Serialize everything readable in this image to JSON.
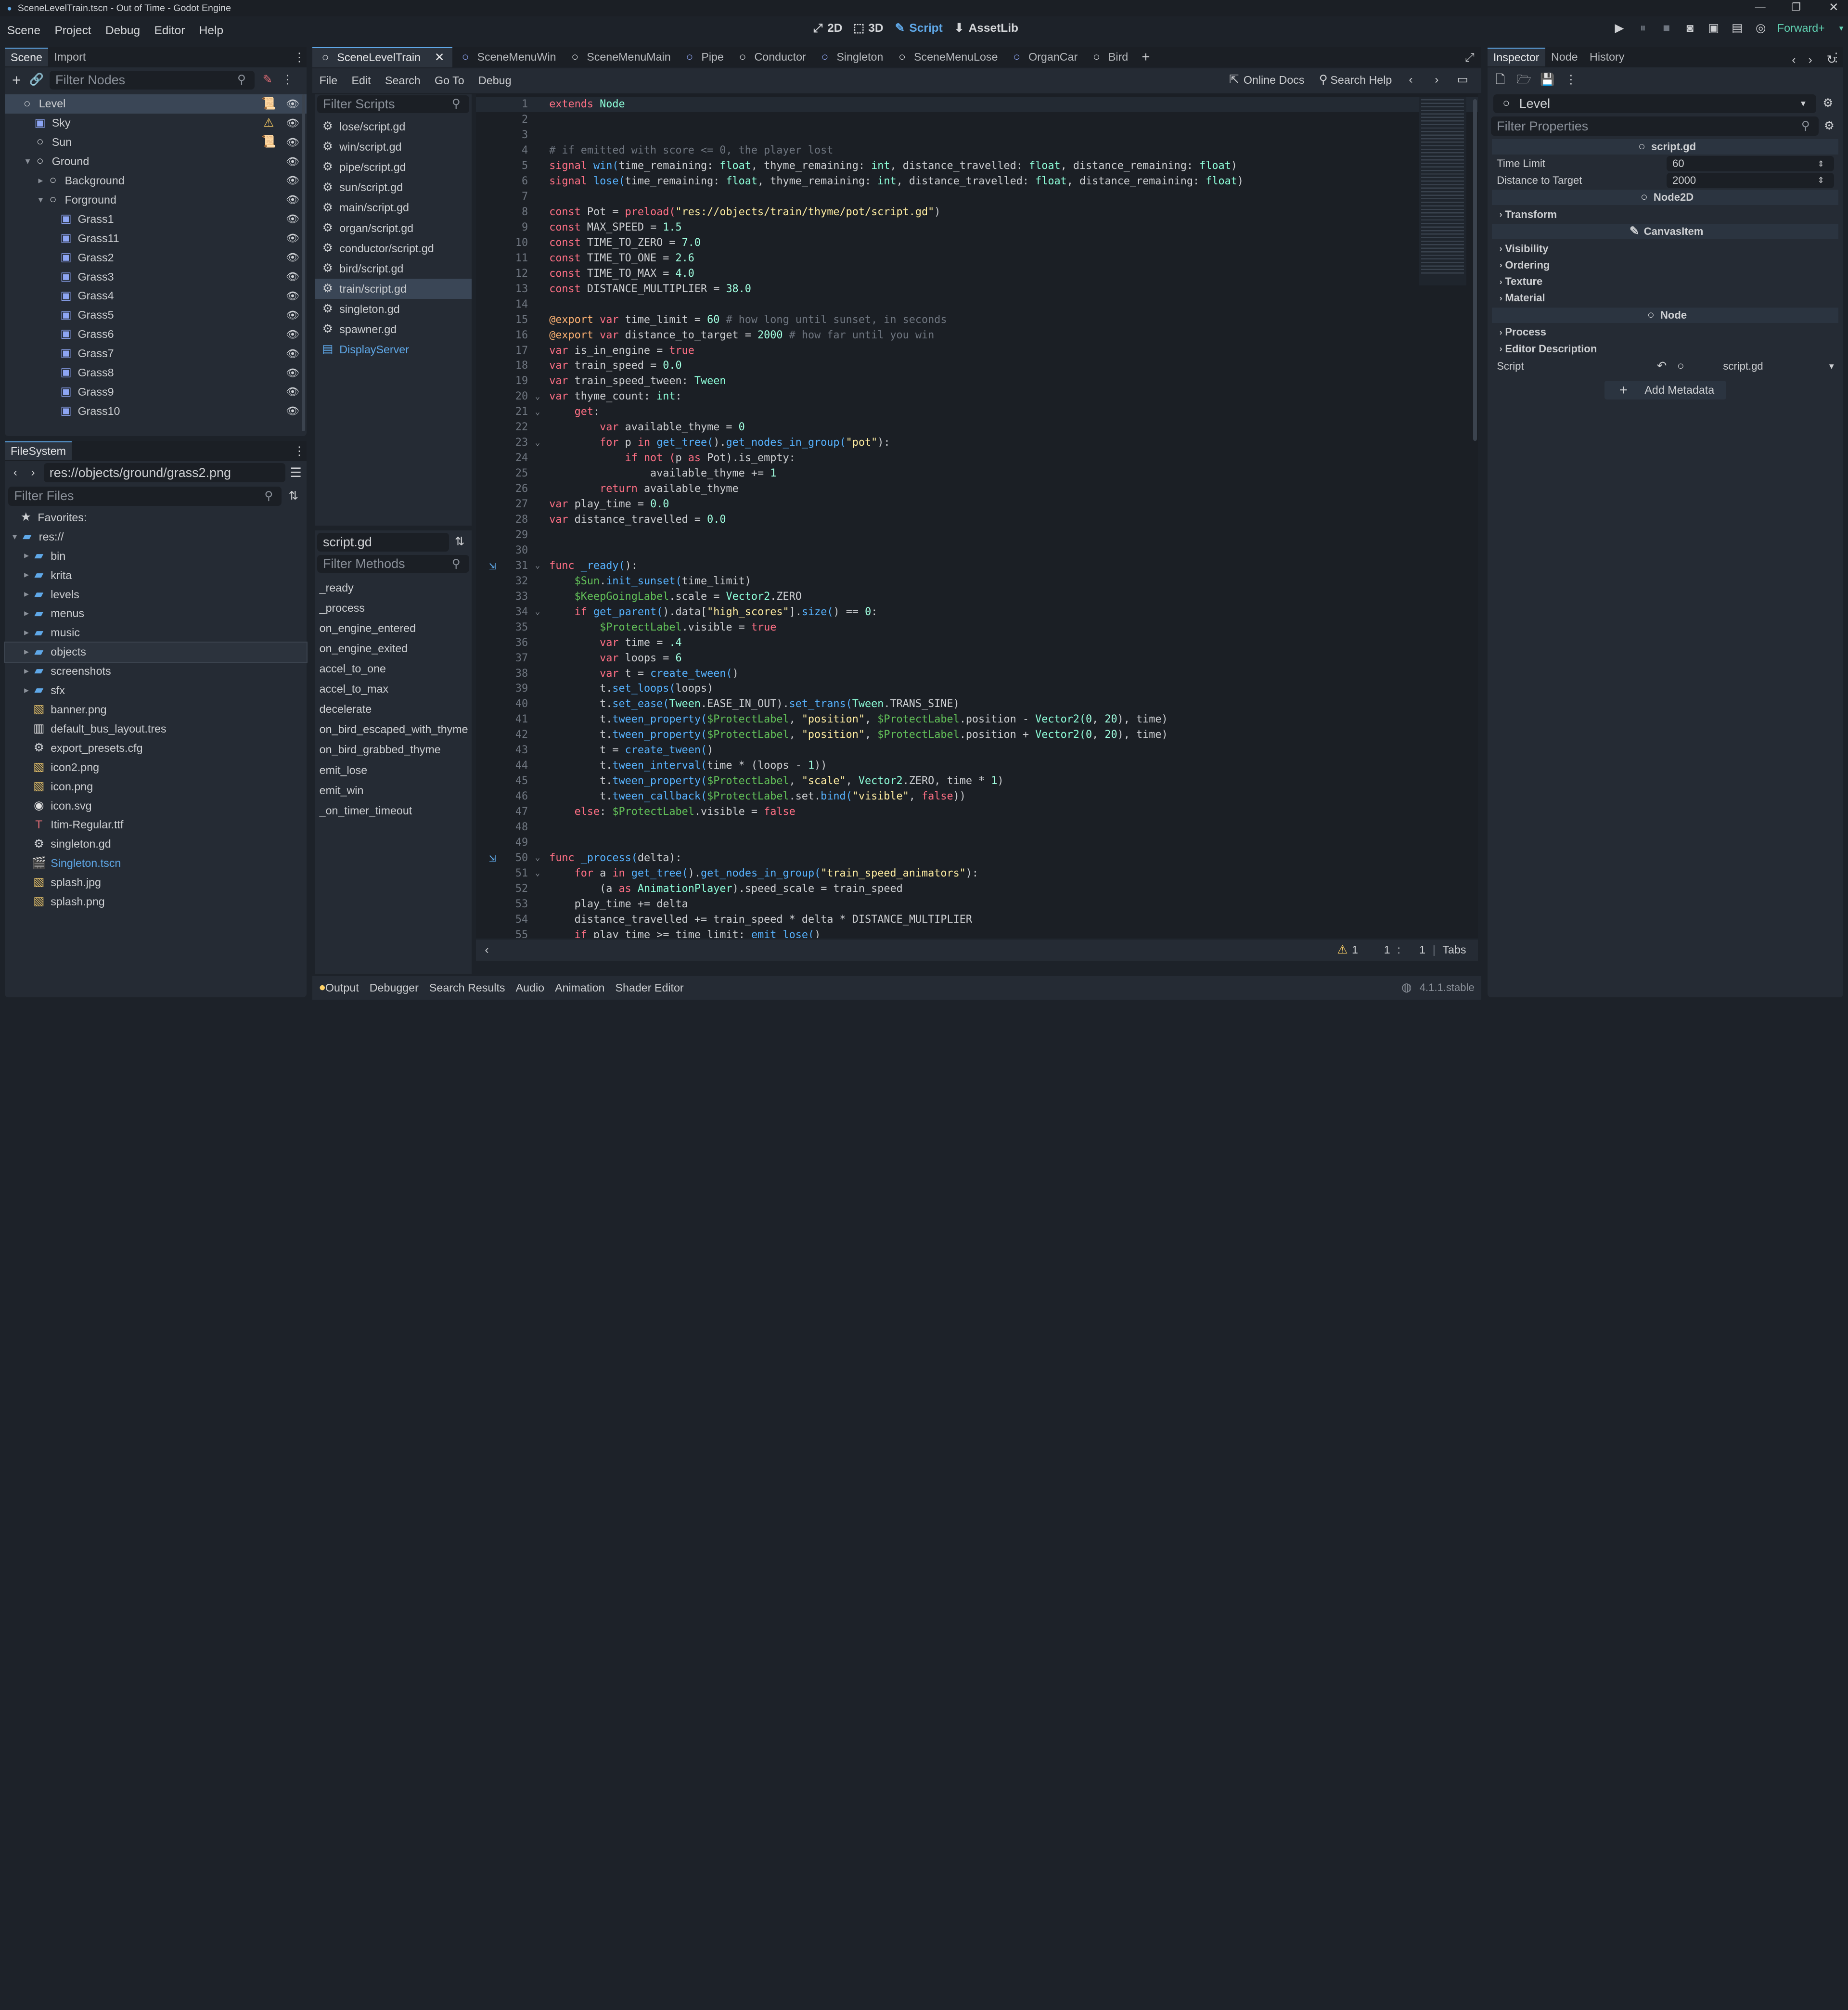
{
  "window": {
    "title": "SceneLevelTrain.tscn - Out of Time - Godot Engine"
  },
  "menu": {
    "items": [
      "Scene",
      "Project",
      "Debug",
      "Editor",
      "Help"
    ]
  },
  "workspaces": {
    "items": [
      "2D",
      "3D",
      "Script",
      "AssetLib"
    ],
    "active": "Script"
  },
  "renderer": {
    "label": "Forward+"
  },
  "scene_dock": {
    "tabs": [
      "Scene",
      "Import"
    ],
    "filter_placeholder": "Filter Nodes",
    "nodes": [
      {
        "name": "Level",
        "depth": 0,
        "icon": "node2d-icon",
        "selected": true
      },
      {
        "name": "Sky",
        "depth": 1,
        "icon": "sprite-icon",
        "warning": true
      },
      {
        "name": "Sun",
        "depth": 1,
        "icon": "node2d-icon",
        "script": true
      },
      {
        "name": "Ground",
        "depth": 1,
        "icon": "node2d-icon",
        "expanded": true
      },
      {
        "name": "Background",
        "depth": 2,
        "icon": "node2d-icon",
        "collapsed": true
      },
      {
        "name": "Forground",
        "depth": 2,
        "icon": "node2d-icon",
        "expanded": true
      },
      {
        "name": "Grass1",
        "depth": 3,
        "icon": "sprite-icon"
      },
      {
        "name": "Grass11",
        "depth": 3,
        "icon": "sprite-icon"
      },
      {
        "name": "Grass2",
        "depth": 3,
        "icon": "sprite-icon"
      },
      {
        "name": "Grass3",
        "depth": 3,
        "icon": "sprite-icon"
      },
      {
        "name": "Grass4",
        "depth": 3,
        "icon": "sprite-icon"
      },
      {
        "name": "Grass5",
        "depth": 3,
        "icon": "sprite-icon"
      },
      {
        "name": "Grass6",
        "depth": 3,
        "icon": "sprite-icon"
      },
      {
        "name": "Grass7",
        "depth": 3,
        "icon": "sprite-icon"
      },
      {
        "name": "Grass8",
        "depth": 3,
        "icon": "sprite-icon"
      },
      {
        "name": "Grass9",
        "depth": 3,
        "icon": "sprite-icon"
      },
      {
        "name": "Grass10",
        "depth": 3,
        "icon": "sprite-icon"
      }
    ]
  },
  "filesystem": {
    "title": "FileSystem",
    "path": "res://objects/ground/grass2.png",
    "filter_placeholder": "Filter Files",
    "favorites_label": "Favorites:",
    "items": [
      {
        "name": "res://",
        "depth": 0,
        "type": "folder",
        "expanded": true
      },
      {
        "name": "bin",
        "depth": 1,
        "type": "folder"
      },
      {
        "name": "krita",
        "depth": 1,
        "type": "folder"
      },
      {
        "name": "levels",
        "depth": 1,
        "type": "folder"
      },
      {
        "name": "menus",
        "depth": 1,
        "type": "folder"
      },
      {
        "name": "music",
        "depth": 1,
        "type": "folder"
      },
      {
        "name": "objects",
        "depth": 1,
        "type": "folder",
        "selected": true
      },
      {
        "name": "screenshots",
        "depth": 1,
        "type": "folder"
      },
      {
        "name": "sfx",
        "depth": 1,
        "type": "folder"
      },
      {
        "name": "banner.png",
        "depth": 1,
        "type": "image"
      },
      {
        "name": "default_bus_layout.tres",
        "depth": 1,
        "type": "resource"
      },
      {
        "name": "export_presets.cfg",
        "depth": 1,
        "type": "config"
      },
      {
        "name": "icon2.png",
        "depth": 1,
        "type": "image"
      },
      {
        "name": "icon.png",
        "depth": 1,
        "type": "image"
      },
      {
        "name": "icon.svg",
        "depth": 1,
        "type": "svg"
      },
      {
        "name": "Itim-Regular.ttf",
        "depth": 1,
        "type": "font"
      },
      {
        "name": "singleton.gd",
        "depth": 1,
        "type": "script"
      },
      {
        "name": "Singleton.tscn",
        "depth": 1,
        "type": "scene",
        "highlight": true
      },
      {
        "name": "splash.jpg",
        "depth": 1,
        "type": "image"
      },
      {
        "name": "splash.png",
        "depth": 1,
        "type": "image"
      }
    ]
  },
  "scene_tabs": [
    {
      "label": "SceneLevelTrain",
      "active": true,
      "closable": true
    },
    {
      "label": "SceneMenuWin"
    },
    {
      "label": "SceneMenuMain"
    },
    {
      "label": "Pipe"
    },
    {
      "label": "Conductor"
    },
    {
      "label": "Singleton"
    },
    {
      "label": "SceneMenuLose"
    },
    {
      "label": "OrganCar"
    },
    {
      "label": "Bird"
    }
  ],
  "script_menu": {
    "items": [
      "File",
      "Edit",
      "Search",
      "Go To",
      "Debug"
    ],
    "online_docs": "Online Docs",
    "search_help": "Search Help"
  },
  "scripts": {
    "filter_placeholder": "Filter Scripts",
    "items": [
      {
        "label": "lose/script.gd"
      },
      {
        "label": "win/script.gd"
      },
      {
        "label": "pipe/script.gd"
      },
      {
        "label": "sun/script.gd"
      },
      {
        "label": "main/script.gd"
      },
      {
        "label": "organ/script.gd"
      },
      {
        "label": "conductor/script.gd"
      },
      {
        "label": "bird/script.gd"
      },
      {
        "label": "train/script.gd",
        "selected": true
      },
      {
        "label": "singleton.gd"
      },
      {
        "label": "spawner.gd"
      },
      {
        "label": "DisplayServer",
        "doc": true
      }
    ],
    "current_file": "script.gd",
    "methods_filter_placeholder": "Filter Methods",
    "methods": [
      "_ready",
      "_process",
      "on_engine_entered",
      "on_engine_exited",
      "accel_to_one",
      "accel_to_max",
      "decelerate",
      "on_bird_escaped_with_thyme",
      "on_bird_grabbed_thyme",
      "emit_lose",
      "emit_win",
      "_on_timer_timeout"
    ]
  },
  "code": {
    "lines": [
      {
        "n": "1",
        "t": "extends Node"
      },
      {
        "n": "2",
        "t": ""
      },
      {
        "n": "3",
        "t": ""
      },
      {
        "n": "4",
        "t": "# if emitted with score <= 0, the player lost"
      },
      {
        "n": "5",
        "t": "signal win(time_remaining: float, thyme_remaining: int, distance_travelled: float, distance_remaining: float)"
      },
      {
        "n": "6",
        "t": "signal lose(time_remaining: float, thyme_remaining: int, distance_travelled: float, distance_remaining: float)"
      },
      {
        "n": "7",
        "t": ""
      },
      {
        "n": "8",
        "t": "const Pot = preload(\"res://objects/train/thyme/pot/script.gd\")"
      },
      {
        "n": "9",
        "t": "const MAX_SPEED = 1.5"
      },
      {
        "n": "10",
        "t": "const TIME_TO_ZERO = 7.0"
      },
      {
        "n": "11",
        "t": "const TIME_TO_ONE = 2.6"
      },
      {
        "n": "12",
        "t": "const TIME_TO_MAX = 4.0"
      },
      {
        "n": "13",
        "t": "const DISTANCE_MULTIPLIER = 38.0"
      },
      {
        "n": "14",
        "t": ""
      },
      {
        "n": "15",
        "t": "@export var time_limit = 60 # how long until sunset, in seconds"
      },
      {
        "n": "16",
        "t": "@export var distance_to_target = 2000 # how far until you win"
      },
      {
        "n": "17",
        "t": "var is_in_engine = true"
      },
      {
        "n": "18",
        "t": "var train_speed = 0.0"
      },
      {
        "n": "19",
        "t": "var train_speed_tween: Tween"
      },
      {
        "n": "20",
        "t": "var thyme_count: int:",
        "fold": true
      },
      {
        "n": "21",
        "t": "    get:",
        "fold": true
      },
      {
        "n": "22",
        "t": "        var available_thyme = 0"
      },
      {
        "n": "23",
        "t": "        for p in get_tree().get_nodes_in_group(\"pot\"):",
        "fold": true
      },
      {
        "n": "24",
        "t": "            if not (p as Pot).is_empty:"
      },
      {
        "n": "25",
        "t": "                available_thyme += 1"
      },
      {
        "n": "26",
        "t": "        return available_thyme"
      },
      {
        "n": "27",
        "t": "var play_time = 0.0"
      },
      {
        "n": "28",
        "t": "var distance_travelled = 0.0"
      },
      {
        "n": "29",
        "t": ""
      },
      {
        "n": "30",
        "t": ""
      },
      {
        "n": "31",
        "t": "func _ready():",
        "fold": true,
        "connected": true
      },
      {
        "n": "32",
        "t": "    $Sun.init_sunset(time_limit)"
      },
      {
        "n": "33",
        "t": "    $KeepGoingLabel.scale = Vector2.ZERO"
      },
      {
        "n": "34",
        "t": "    if get_parent().data[\"high_scores\"].size() == 0:",
        "fold": true
      },
      {
        "n": "35",
        "t": "        $ProtectLabel.visible = true"
      },
      {
        "n": "36",
        "t": "        var time = .4"
      },
      {
        "n": "37",
        "t": "        var loops = 6"
      },
      {
        "n": "38",
        "t": "        var t = create_tween()"
      },
      {
        "n": "39",
        "t": "        t.set_loops(loops)"
      },
      {
        "n": "40",
        "t": "        t.set_ease(Tween.EASE_IN_OUT).set_trans(Tween.TRANS_SINE)"
      },
      {
        "n": "41",
        "t": "        t.tween_property($ProtectLabel, \"position\", $ProtectLabel.position - Vector2(0, 20), time)"
      },
      {
        "n": "42",
        "t": "        t.tween_property($ProtectLabel, \"position\", $ProtectLabel.position + Vector2(0, 20), time)"
      },
      {
        "n": "43",
        "t": "        t = create_tween()"
      },
      {
        "n": "44",
        "t": "        t.tween_interval(time * (loops - 1))"
      },
      {
        "n": "45",
        "t": "        t.tween_property($ProtectLabel, \"scale\", Vector2.ZERO, time * 1)"
      },
      {
        "n": "46",
        "t": "        t.tween_callback($ProtectLabel.set.bind(\"visible\", false))"
      },
      {
        "n": "47",
        "t": "    else: $ProtectLabel.visible = false"
      },
      {
        "n": "48",
        "t": ""
      },
      {
        "n": "49",
        "t": ""
      },
      {
        "n": "50",
        "t": "func _process(delta):",
        "fold": true,
        "connected": true
      },
      {
        "n": "51",
        "t": "    for a in get_tree().get_nodes_in_group(\"train_speed_animators\"):",
        "fold": true
      },
      {
        "n": "52",
        "t": "        (a as AnimationPlayer).speed_scale = train_speed"
      },
      {
        "n": "53",
        "t": "    play_time += delta"
      },
      {
        "n": "54",
        "t": "    distance_travelled += train_speed * delta * DISTANCE_MULTIPLIER"
      },
      {
        "n": "55",
        "t": "    if play_time >= time_limit: emit_lose()"
      }
    ]
  },
  "status": {
    "warnings": "1",
    "line": "1",
    "col": "1",
    "indent": "Tabs"
  },
  "bottom_tabs": [
    "Output",
    "Debugger",
    "Search Results",
    "Audio",
    "Animation",
    "Shader Editor"
  ],
  "version": "4.1.1.stable",
  "inspector": {
    "tabs": [
      "Inspector",
      "Node",
      "History"
    ],
    "object": "Level",
    "filter_placeholder": "Filter Properties",
    "script_section": "script.gd",
    "props": [
      {
        "label": "Time Limit",
        "value": "60"
      },
      {
        "label": "Distance to Target",
        "value": "2000"
      }
    ],
    "node2d_section": "Node2D",
    "node2d_groups": [
      "Transform"
    ],
    "canvas_section": "CanvasItem",
    "canvas_groups": [
      "Visibility",
      "Ordering",
      "Texture",
      "Material"
    ],
    "node_section": "Node",
    "node_groups": [
      "Process",
      "Editor Description"
    ],
    "script_label": "Script",
    "script_value": "script.gd",
    "add_metadata": "Add Metadata"
  },
  "colors": {
    "accent": "#5fa8e8",
    "keyword": "#ff7085",
    "string": "#ffeda1",
    "number": "#a1ffe0",
    "comment": "#6f7680",
    "function": "#57b3ff",
    "type": "#8effda",
    "warning": "#ffd166"
  }
}
